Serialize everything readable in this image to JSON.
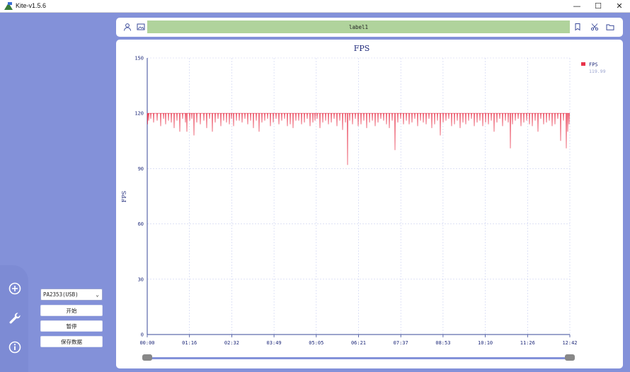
{
  "window": {
    "title": "Kite-v1.5.6",
    "minimize": "—",
    "maximize": "☐",
    "close": "✕"
  },
  "sidebar": {
    "icons": [
      "add-circle-icon",
      "wrench-icon",
      "info-icon"
    ]
  },
  "controls": {
    "device": "PA2353(USB)",
    "start": "开始",
    "pause": "暂停",
    "save": "保存数据"
  },
  "toolbar": {
    "label": "label1"
  },
  "chart_data": {
    "type": "line",
    "title": "FPS",
    "ylabel": "FPS",
    "xlabel": "",
    "ylim": [
      0,
      150
    ],
    "yticks": [
      "0",
      "30",
      "60",
      "90",
      "120",
      "150"
    ],
    "xticks": [
      "00:00",
      "01:16",
      "02:32",
      "03:49",
      "05:05",
      "06:21",
      "07:37",
      "08:53",
      "10:10",
      "11:26",
      "12:42"
    ],
    "grid": true,
    "legend_position": "top-right",
    "series": [
      {
        "name": "FPS",
        "legend_value": "119.99",
        "color": "#e8334a",
        "baseline": 120,
        "dips": [
          [
            0.5,
            114
          ],
          [
            2,
            116
          ],
          [
            5,
            117
          ],
          [
            9,
            115
          ],
          [
            14,
            116
          ],
          [
            19,
            113
          ],
          [
            23,
            117
          ],
          [
            26,
            114
          ],
          [
            30,
            116
          ],
          [
            34,
            115
          ],
          [
            38,
            112
          ],
          [
            42,
            116
          ],
          [
            46,
            110
          ],
          [
            50,
            117
          ],
          [
            54,
            115
          ],
          [
            56,
            110
          ],
          [
            60,
            116
          ],
          [
            63,
            117
          ],
          [
            66,
            108
          ],
          [
            70,
            115
          ],
          [
            75,
            114
          ],
          [
            80,
            116
          ],
          [
            84,
            112
          ],
          [
            88,
            117
          ],
          [
            92,
            110
          ],
          [
            96,
            115
          ],
          [
            100,
            117
          ],
          [
            104,
            113
          ],
          [
            108,
            116
          ],
          [
            112,
            115
          ],
          [
            116,
            114
          ],
          [
            119,
            117
          ],
          [
            122,
            113
          ],
          [
            126,
            116
          ],
          [
            130,
            116
          ],
          [
            134,
            115
          ],
          [
            138,
            117
          ],
          [
            142,
            114
          ],
          [
            146,
            116
          ],
          [
            150,
            112
          ],
          [
            154,
            116
          ],
          [
            158,
            110
          ],
          [
            162,
            115
          ],
          [
            166,
            116
          ],
          [
            170,
            117
          ],
          [
            174,
            113
          ],
          [
            178,
            115
          ],
          [
            182,
            117
          ],
          [
            186,
            114
          ],
          [
            190,
            116
          ],
          [
            194,
            117
          ],
          [
            198,
            113
          ],
          [
            202,
            114
          ],
          [
            206,
            112
          ],
          [
            210,
            116
          ],
          [
            214,
            116
          ],
          [
            218,
            114
          ],
          [
            222,
            115
          ],
          [
            226,
            117
          ],
          [
            230,
            113
          ],
          [
            234,
            115
          ],
          [
            237,
            116
          ],
          [
            240,
            117
          ],
          [
            244,
            112
          ],
          [
            248,
            115
          ],
          [
            252,
            116
          ],
          [
            256,
            114
          ],
          [
            260,
            115
          ],
          [
            264,
            117
          ],
          [
            268,
            113
          ],
          [
            272,
            116
          ],
          [
            276,
            111
          ],
          [
            280,
            115
          ],
          [
            283,
            92
          ],
          [
            286,
            116
          ],
          [
            290,
            114
          ],
          [
            294,
            117
          ],
          [
            298,
            113
          ],
          [
            302,
            114
          ],
          [
            306,
            116
          ],
          [
            310,
            112
          ],
          [
            314,
            115
          ],
          [
            318,
            116
          ],
          [
            322,
            113
          ],
          [
            326,
            115
          ],
          [
            330,
            117
          ],
          [
            334,
            116
          ],
          [
            338,
            114
          ],
          [
            342,
            112
          ],
          [
            346,
            116
          ],
          [
            350,
            100
          ],
          [
            354,
            115
          ],
          [
            358,
            117
          ],
          [
            362,
            114
          ],
          [
            366,
            116
          ],
          [
            370,
            114
          ],
          [
            374,
            115
          ],
          [
            378,
            117
          ],
          [
            382,
            113
          ],
          [
            386,
            116
          ],
          [
            390,
            115
          ],
          [
            394,
            114
          ],
          [
            398,
            117
          ],
          [
            402,
            112
          ],
          [
            406,
            114
          ],
          [
            410,
            116
          ],
          [
            414,
            108
          ],
          [
            418,
            115
          ],
          [
            422,
            116
          ],
          [
            426,
            117
          ],
          [
            430,
            113
          ],
          [
            434,
            114
          ],
          [
            438,
            116
          ],
          [
            442,
            112
          ],
          [
            446,
            115
          ],
          [
            450,
            114
          ],
          [
            454,
            116
          ],
          [
            458,
            117
          ],
          [
            462,
            113
          ],
          [
            466,
            115
          ],
          [
            470,
            116
          ],
          [
            474,
            113
          ],
          [
            478,
            115
          ],
          [
            482,
            114
          ],
          [
            486,
            116
          ],
          [
            490,
            110
          ],
          [
            494,
            115
          ],
          [
            498,
            117
          ],
          [
            502,
            113
          ],
          [
            506,
            116
          ],
          [
            510,
            115
          ],
          [
            513,
            101
          ],
          [
            516,
            114
          ],
          [
            520,
            116
          ],
          [
            524,
            117
          ],
          [
            528,
            113
          ],
          [
            532,
            115
          ],
          [
            536,
            116
          ],
          [
            540,
            114
          ],
          [
            544,
            113
          ],
          [
            548,
            116
          ],
          [
            552,
            110
          ],
          [
            556,
            117
          ],
          [
            560,
            114
          ],
          [
            564,
            115
          ],
          [
            568,
            116
          ],
          [
            572,
            113
          ],
          [
            576,
            114
          ],
          [
            580,
            117
          ],
          [
            584,
            105
          ],
          [
            588,
            116
          ],
          [
            592,
            101
          ],
          [
            594,
            110
          ],
          [
            596,
            114
          ]
        ]
      }
    ]
  }
}
